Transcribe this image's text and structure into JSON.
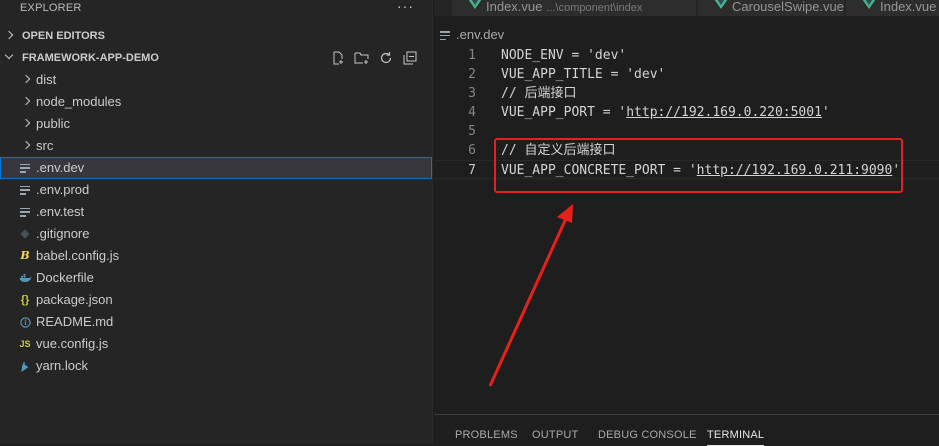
{
  "explorer": {
    "title": "EXPLORER",
    "more_label": "···",
    "open_editors_label": "OPEN EDITORS",
    "project_label": "FRAMEWORK-APP-DEMO",
    "items": [
      {
        "label": "dist",
        "kind": "folder"
      },
      {
        "label": "node_modules",
        "kind": "folder"
      },
      {
        "label": "public",
        "kind": "folder"
      },
      {
        "label": "src",
        "kind": "folder"
      },
      {
        "label": ".env.dev",
        "kind": "env",
        "selected": true
      },
      {
        "label": ".env.prod",
        "kind": "env"
      },
      {
        "label": ".env.test",
        "kind": "env"
      },
      {
        "label": ".gitignore",
        "kind": "git"
      },
      {
        "label": "babel.config.js",
        "kind": "babel"
      },
      {
        "label": "Dockerfile",
        "kind": "docker"
      },
      {
        "label": "package.json",
        "kind": "json"
      },
      {
        "label": "README.md",
        "kind": "info"
      },
      {
        "label": "vue.config.js",
        "kind": "js"
      },
      {
        "label": "yarn.lock",
        "kind": "yarn"
      }
    ]
  },
  "tabs": [
    {
      "label": "Index.vue",
      "description": "...\\component\\index"
    },
    {
      "label": "CarouselSwipe.vue",
      "description": ""
    },
    {
      "label": "Index.vue",
      "description": ""
    }
  ],
  "breadcrumb": ".env.dev",
  "code": {
    "lines": [
      {
        "n": "1",
        "before": "NODE_ENV = 'dev'",
        "url": "",
        "after": ""
      },
      {
        "n": "2",
        "before": "VUE_APP_TITLE = 'dev'",
        "url": "",
        "after": ""
      },
      {
        "n": "3",
        "before": "// 后端接口",
        "url": "",
        "after": ""
      },
      {
        "n": "4",
        "before": "VUE_APP_PORT = '",
        "url": "http://192.169.0.220:5001",
        "after": "'"
      },
      {
        "n": "5",
        "before": "",
        "url": "",
        "after": ""
      },
      {
        "n": "6",
        "before": "// 自定义后端接口",
        "url": "",
        "after": ""
      },
      {
        "n": "7",
        "before": "VUE_APP_CONCRETE_PORT = '",
        "url": "http://192.169.0.211:9090",
        "after": "'"
      }
    ]
  },
  "panel_tabs": [
    "PROBLEMS",
    "OUTPUT",
    "DEBUG CONSOLE",
    "TERMINAL"
  ],
  "colors": {
    "highlight_box": "#e8201c",
    "arrow": "#e8201c",
    "selection_border": "#0078d4",
    "vue_green": "#41b883"
  }
}
